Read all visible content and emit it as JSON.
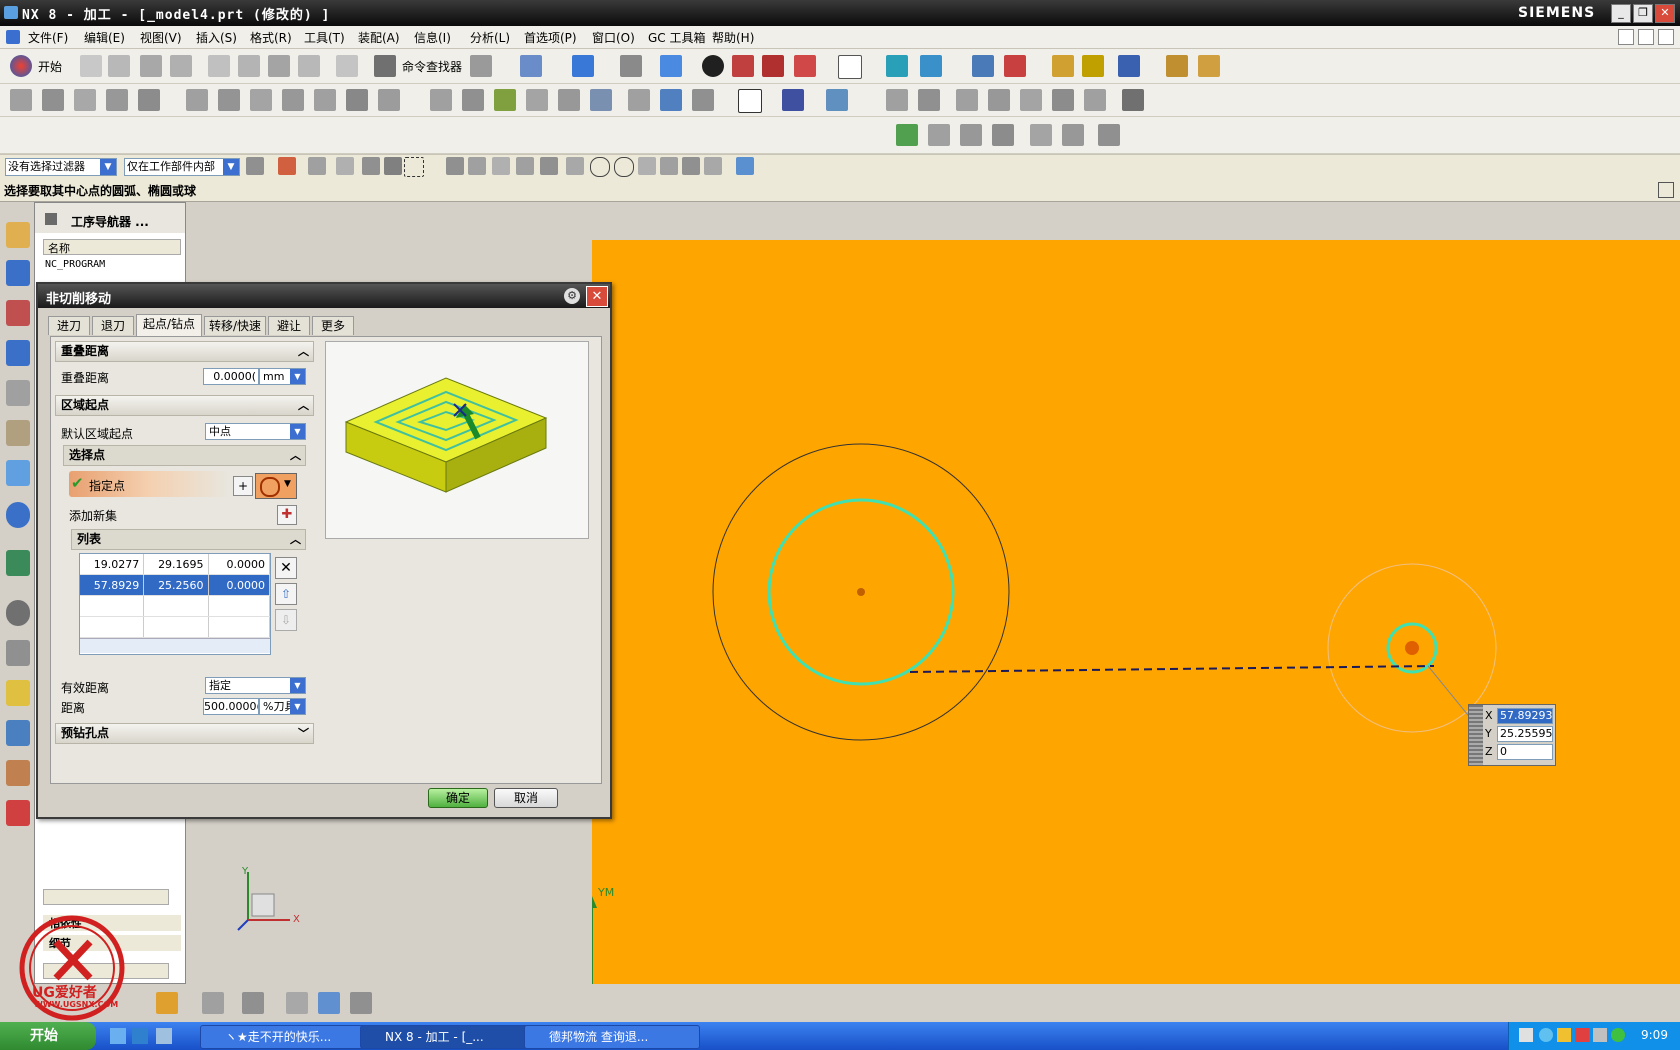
{
  "window": {
    "title": "NX 8 - 加工 - [_model4.prt (修改的) ]",
    "brand": "SIEMENS",
    "controls": [
      "_",
      "❐",
      "✕"
    ]
  },
  "menu": {
    "items": [
      "文件(F)",
      "编辑(E)",
      "视图(V)",
      "插入(S)",
      "格式(R)",
      "工具(T)",
      "装配(A)",
      "信息(I)",
      "分析(L)",
      "首选项(P)",
      "窗口(O)",
      "GC 工具箱",
      "帮助(H)"
    ]
  },
  "toolbar": {
    "start_label": "开始",
    "command_finder_label": "命令查找器"
  },
  "selection": {
    "filter": "没有选择过滤器",
    "scope": "仅在工作部件内部"
  },
  "cue": "选择要取其中心点的圆弧、椭圆或球",
  "navigator": {
    "title": "工序导航器 ...",
    "column_header": "名称",
    "root": "NC_PROGRAM",
    "bottom_labels": [
      "相依性",
      "细节"
    ]
  },
  "dialog": {
    "title": "非切削移动",
    "tabs": [
      "进刀",
      "退刀",
      "起点/钻点",
      "转移/快速",
      "避让",
      "更多"
    ],
    "active_tab": "起点/钻点",
    "overlap": {
      "section": "重叠距离",
      "label": "重叠距离",
      "value": "0.0000(",
      "unit": "mm"
    },
    "region_start": {
      "section": "区域起点",
      "default_label": "默认区域起点",
      "default_value": "中点",
      "select_point_section": "选择点",
      "specify_point": "指定点",
      "add_new_set": "添加新集",
      "list_section": "列表",
      "rows": [
        [
          "19.0277",
          "29.1695",
          "0.0000"
        ],
        [
          "57.8929",
          "25.2560",
          "0.0000"
        ]
      ],
      "effective_distance_label": "有效距离",
      "effective_distance_value": "指定",
      "distance_label": "距离",
      "distance_value": "500.0000(",
      "distance_unit": "%刀具"
    },
    "predrill": {
      "section": "预钻孔点"
    },
    "ok": "确定",
    "cancel": "取消"
  },
  "coord_input": {
    "x_label": "X",
    "x": "57.89293",
    "y_label": "Y",
    "y": "25.25595",
    "z_label": "Z",
    "z": "0"
  },
  "view": {
    "ym_label": "YM",
    "y_label": "Y",
    "x_label": "X"
  },
  "watermark": {
    "text": "UG爱好者",
    "url": "WWW.UGSNX.COM"
  },
  "taskbar": {
    "start": "开始",
    "tasks": [
      "ヽ★走不开的快乐...",
      "NX 8 - 加工 - [_...",
      "德邦物流 查询退..."
    ],
    "clock": "9:09"
  },
  "colors": {
    "graphics_background": "#ffa500",
    "circle_highlight": "#40e0b0",
    "selection_row": "#316ac5",
    "title_bar": "#1a1a1a"
  }
}
